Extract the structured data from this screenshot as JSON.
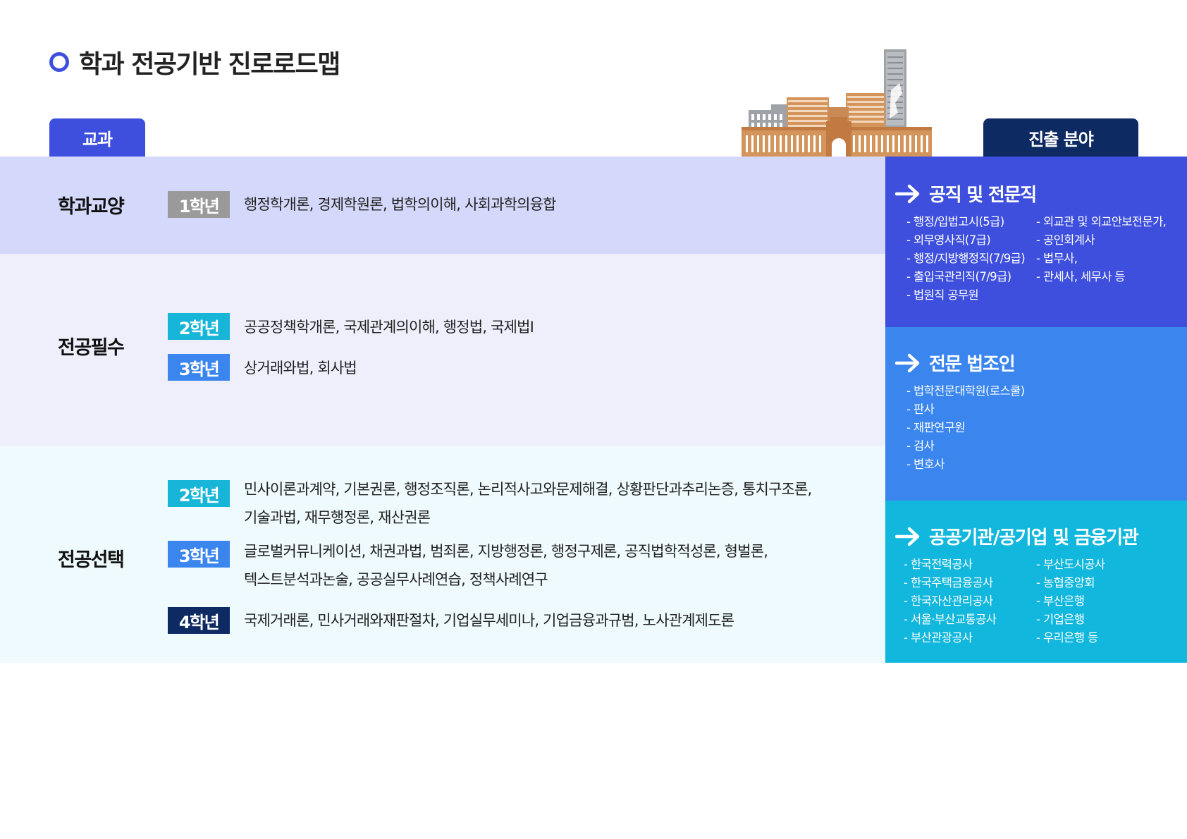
{
  "title": "학과 전공기반 진로로드맵",
  "tabs": {
    "left": "교과",
    "right": "진출 분야"
  },
  "sections": [
    {
      "category": "학과교양",
      "rows": [
        {
          "grade": "1학년",
          "courses": [
            "행정학개론, 경제학원론, 법학의이해, 사회과학의융합"
          ]
        }
      ]
    },
    {
      "category": "전공필수",
      "rows": [
        {
          "grade": "2학년",
          "courses": [
            "공공정책학개론, 국제관계의이해, 행정법, 국제법I"
          ]
        },
        {
          "grade": "3학년",
          "courses": [
            "상거래와법, 회사법"
          ]
        }
      ]
    },
    {
      "category": "전공선택",
      "rows": [
        {
          "grade": "2학년",
          "courses": [
            "민사이론과계약, 기본권론, 행정조직론, 논리적사고와문제해결, 상황판단과추리논증, 통치구조론,",
            "기술과법, 재무행정론, 재산권론"
          ]
        },
        {
          "grade": "3학년",
          "courses": [
            "글로벌커뮤니케이션, 채권과법, 범죄론, 지방행정론, 행정구제론, 공직법학적성론, 형벌론,",
            "텍스트분석과논술, 공공실무사례연습, 정책사례연구"
          ]
        },
        {
          "grade": "4학년",
          "courses": [
            "국제거래론, 민사거래와재판절차, 기업실무세미나, 기업금융과규범, 노사관계제도론"
          ]
        }
      ]
    }
  ],
  "careers": [
    {
      "title": "공직 및 전문직",
      "col1": [
        "- 행정/입법고시(5급)",
        "- 외무영사직(7급)",
        "- 행정/지방행정직(7/9급)",
        "- 출입국관리직(7/9급)",
        "- 법원직 공무원"
      ],
      "col2": [
        "- 외교관 및 외교안보전문가,",
        "- 공인회계사",
        "- 법무사,",
        "- 관세사, 세무사 등"
      ]
    },
    {
      "title": "전문 법조인",
      "col1": [
        "- 법학전문대학원(로스쿨)",
        "- 판사",
        "- 재판연구원",
        "- 검사",
        "- 변호사"
      ],
      "col2": []
    },
    {
      "title": "공공기관/공기업 및 금융기관",
      "col1": [
        "- 한국전력공사",
        "- 한국주택금융공사",
        "- 한국자산관리공사",
        "- 서울·부산교통공사",
        "- 부산관광공사"
      ],
      "col2": [
        "- 부산도시공사",
        "- 농협중앙회",
        "- 부산은행",
        "- 기업은행",
        "- 우리은행 등"
      ]
    }
  ],
  "colors": {
    "primary": "#3d4fdc",
    "navy": "#0e2a63",
    "blue": "#3a86ee",
    "cyan": "#17b5d8",
    "gray": "#9a9a9a"
  }
}
